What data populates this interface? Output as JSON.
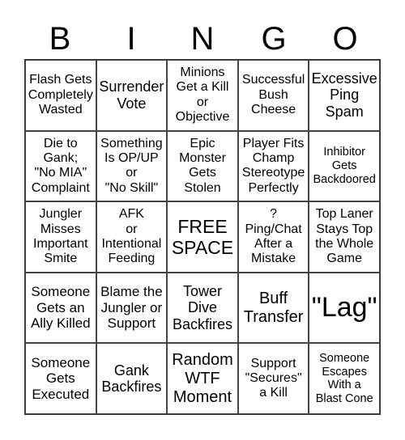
{
  "header": [
    "B",
    "I",
    "N",
    "G",
    "O"
  ],
  "cells": [
    [
      "Flash Gets\nCompletely\nWasted",
      "Surrender\nVote",
      "Minions\nGet a Kill\nor\nObjective",
      "Successful\nBush\nCheese",
      "Excessive\nPing\nSpam"
    ],
    [
      "Die to\nGank;\n\"No MIA\"\nComplaint",
      "Something\nIs OP/UP\nor\n\"No Skill\"",
      "Epic\nMonster\nGets\nStolen",
      "Player Fits\nChamp\nStereotype\nPerfectly",
      "Inhibitor\nGets\nBackdoored"
    ],
    [
      "Jungler\nMisses\nImportant\nSmite",
      "AFK\nor\nIntentional\nFeeding",
      "FREE\nSPACE",
      "?\nPing/Chat\nAfter a\nMistake",
      "Top Laner\nStays Top\nthe Whole\nGame"
    ],
    [
      "Someone\nGets an\nAlly Killed",
      "Blame the\nJungler or\nSupport",
      "Tower\nDive\nBackfires",
      "Buff\nTransfer",
      "\"Lag\""
    ],
    [
      "Someone\nGets\nExecuted",
      "Gank\nBackfires",
      "Random\nWTF\nMoment",
      "Support\n\"Secures\"\na Kill",
      "Someone\nEscapes\nWith a\nBlast Cone"
    ]
  ],
  "free_space": {
    "row": 2,
    "col": 2
  }
}
